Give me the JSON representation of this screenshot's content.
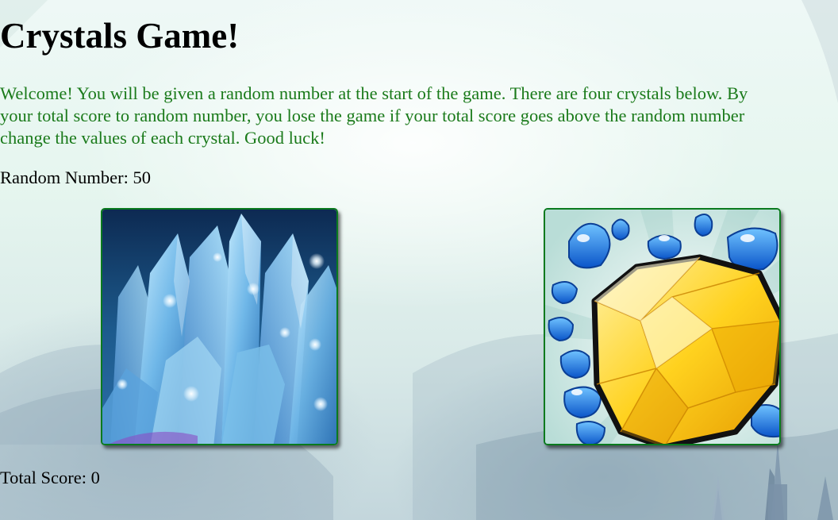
{
  "header": {
    "title": "Crystals Game!"
  },
  "intro": {
    "lines": [
      "Welcome! You will be given a random number at the start of the game. There are four crystals below. By",
      "your total score to random number, you lose the game if your total score goes above the random number",
      "change the values of each crystal. Good luck!"
    ]
  },
  "game": {
    "random_label": "Random Number:",
    "random_value": "50",
    "score_label": "Total Score:",
    "score_value": "0"
  },
  "crystals": [
    {
      "name": "blue ice crystal",
      "icon": "ice-crystal-icon"
    },
    {
      "name": "yellow gem with blue droplets",
      "icon": "yellow-gem-icon"
    }
  ],
  "colors": {
    "intro_text": "#1a7a1a",
    "crystal_border": "#0a7a1e"
  }
}
